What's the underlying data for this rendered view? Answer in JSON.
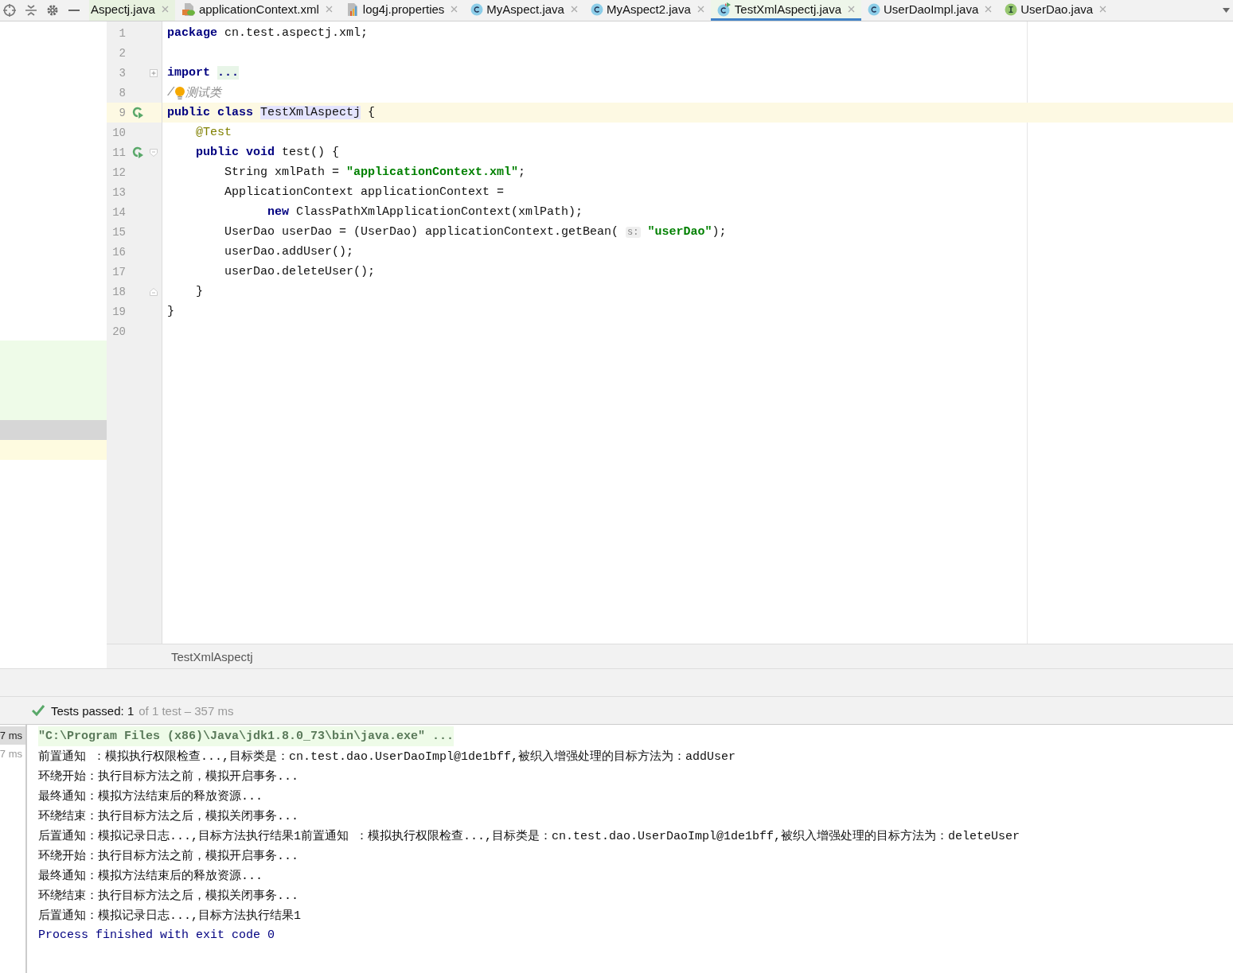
{
  "toolbar": {
    "buttons": [
      {
        "kind": "target"
      },
      {
        "kind": "collapse"
      },
      {
        "kind": "gear"
      },
      {
        "kind": "minus"
      }
    ]
  },
  "tabs": [
    {
      "label": "Aspectj.java",
      "kind": "plain",
      "selected": false
    },
    {
      "label": "applicationContext.xml",
      "kind": "xml",
      "selected": false
    },
    {
      "label": "log4j.properties",
      "kind": "props",
      "selected": false
    },
    {
      "label": "MyAspect.java",
      "kind": "class",
      "selected": false
    },
    {
      "label": "MyAspect2.java",
      "kind": "class",
      "selected": false
    },
    {
      "label": "TestXmlAspectj.java",
      "kind": "testclass",
      "selected": true
    },
    {
      "label": "UserDaoImpl.java",
      "kind": "class",
      "selected": false
    },
    {
      "label": "UserDao.java",
      "kind": "interface",
      "selected": false
    }
  ],
  "editor": {
    "lines": [
      {
        "number": "1",
        "kind": "plain",
        "current": false,
        "run": false,
        "tokens": [
          {
            "kind": "kw",
            "text": "package"
          },
          {
            "kind": "plain",
            "text": " cn.test.aspectj.xml;"
          }
        ]
      },
      {
        "number": "2",
        "kind": "plain",
        "current": false,
        "run": false
      },
      {
        "number": "3",
        "kind": "collapsed",
        "current": false,
        "run": false,
        "tokens": [
          {
            "kind": "kw",
            "text": "import "
          },
          {
            "kind": "folded",
            "text": "..."
          }
        ]
      },
      {
        "number": "8",
        "kind": "plain",
        "current": false,
        "run": false,
        "tokens": [
          {
            "kind": "comment",
            "text": "/"
          },
          {
            "kind": "bulb"
          },
          {
            "kind": "comment",
            "text": "测试类"
          }
        ]
      },
      {
        "number": "9",
        "kind": "plain",
        "current": true,
        "run": true,
        "tokens": [
          {
            "kind": "kw",
            "text": "public class "
          },
          {
            "kind": "hl",
            "text": "TestXmlAspectj"
          },
          {
            "kind": "plain",
            "text": " {"
          }
        ]
      },
      {
        "number": "10",
        "kind": "plain",
        "current": false,
        "run": false,
        "tokens": [
          {
            "kind": "anno",
            "text": "    @Test"
          }
        ]
      },
      {
        "number": "11",
        "kind": "fold_start",
        "current": false,
        "run": true,
        "tokens": [
          {
            "kind": "kw",
            "text": "    public void"
          },
          {
            "kind": "plain",
            "text": " test() {"
          }
        ]
      },
      {
        "number": "12",
        "kind": "plain",
        "current": false,
        "run": false,
        "tokens": [
          {
            "kind": "plain",
            "text": "        String xmlPath = "
          },
          {
            "kind": "str",
            "text": "\"applicationContext.xml\""
          },
          {
            "kind": "plain",
            "text": ";"
          }
        ]
      },
      {
        "number": "13",
        "kind": "plain",
        "current": false,
        "run": false,
        "tokens": [
          {
            "kind": "plain",
            "text": "        ApplicationContext applicationContext ="
          }
        ]
      },
      {
        "number": "14",
        "kind": "plain",
        "current": false,
        "run": false,
        "tokens": [
          {
            "kind": "kw",
            "text": "              new"
          },
          {
            "kind": "plain",
            "text": " ClassPathXmlApplicationContext(xmlPath);"
          }
        ]
      },
      {
        "number": "15",
        "kind": "plain",
        "current": false,
        "run": false,
        "tokens": [
          {
            "kind": "plain",
            "text": "        UserDao userDao = (UserDao) applicationContext.getBean( "
          },
          {
            "kind": "hint",
            "text": "s:"
          },
          {
            "kind": "str",
            "text": " \"userDao\""
          },
          {
            "kind": "plain",
            "text": ");"
          }
        ]
      },
      {
        "number": "16",
        "kind": "plain",
        "current": false,
        "run": false,
        "tokens": [
          {
            "kind": "plain",
            "text": "        userDao.addUser();"
          }
        ]
      },
      {
        "number": "17",
        "kind": "plain",
        "current": false,
        "run": false,
        "tokens": [
          {
            "kind": "plain",
            "text": "        userDao.deleteUser();"
          }
        ]
      },
      {
        "number": "18",
        "kind": "fold_end",
        "current": false,
        "run": false,
        "tokens": [
          {
            "kind": "plain",
            "text": "    }"
          }
        ]
      },
      {
        "number": "19",
        "kind": "plain",
        "current": false,
        "run": false,
        "tokens": [
          {
            "kind": "plain",
            "text": "}"
          }
        ]
      },
      {
        "number": "20",
        "kind": "plain",
        "current": false,
        "run": false
      }
    ],
    "breadcrumb": "TestXmlAspectj"
  },
  "run_panel": {
    "status": {
      "passed": "Tests passed: 1",
      "detail": "of 1 test – 357 ms"
    },
    "test_tree": [
      {
        "label": "7 ms",
        "selected": true
      },
      {
        "label": "7 ms",
        "selected": false
      }
    ],
    "console": [
      {
        "kind": "command",
        "text": "\"C:\\Program Files (x86)\\Java\\jdk1.8.0_73\\bin\\java.exe\" ..."
      },
      {
        "kind": "out",
        "text": "前置通知 ：模拟执行权限检查...,目标类是：cn.test.dao.UserDaoImpl@1de1bff,被织入增强处理的目标方法为：addUser"
      },
      {
        "kind": "out",
        "text": "环绕开始：执行目标方法之前，模拟开启事务..."
      },
      {
        "kind": "out",
        "text": "最终通知：模拟方法结束后的释放资源..."
      },
      {
        "kind": "out",
        "text": "环绕结束：执行目标方法之后，模拟关闭事务..."
      },
      {
        "kind": "out",
        "text": "后置通知：模拟记录日志...,目标方法执行结果1前置通知 ：模拟执行权限检查...,目标类是：cn.test.dao.UserDaoImpl@1de1bff,被织入增强处理的目标方法为：deleteUser"
      },
      {
        "kind": "out",
        "text": "环绕开始：执行目标方法之前，模拟开启事务..."
      },
      {
        "kind": "out",
        "text": "最终通知：模拟方法结束后的释放资源..."
      },
      {
        "kind": "out",
        "text": "环绕结束：执行目标方法之后，模拟关闭事务..."
      },
      {
        "kind": "out",
        "text": "后置通知：模拟记录日志...,目标方法执行结果1"
      },
      {
        "kind": "exit",
        "text": "Process finished with exit code 0"
      }
    ]
  }
}
